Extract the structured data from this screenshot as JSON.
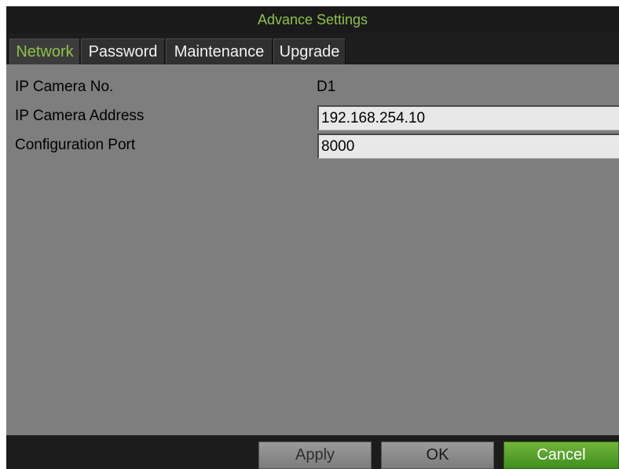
{
  "window": {
    "title": "Advance Settings"
  },
  "tabs": [
    {
      "label": "Network",
      "active": true
    },
    {
      "label": "Password",
      "active": false
    },
    {
      "label": "Maintenance",
      "active": false
    },
    {
      "label": "Upgrade",
      "active": false
    }
  ],
  "form": {
    "camera_no": {
      "label": "IP Camera No.",
      "value": "D1"
    },
    "camera_address": {
      "label": "IP Camera Address",
      "value": "192.168.254.10"
    },
    "config_port": {
      "label": "Configuration Port",
      "value": "8000"
    }
  },
  "buttons": {
    "apply": "Apply",
    "ok": "OK",
    "cancel": "Cancel"
  },
  "colors": {
    "accent_green": "#8bc34a",
    "panel_gray": "#7e7e7e",
    "title_bar": "#1a1a1a",
    "cancel_green": "#4f9e26"
  }
}
